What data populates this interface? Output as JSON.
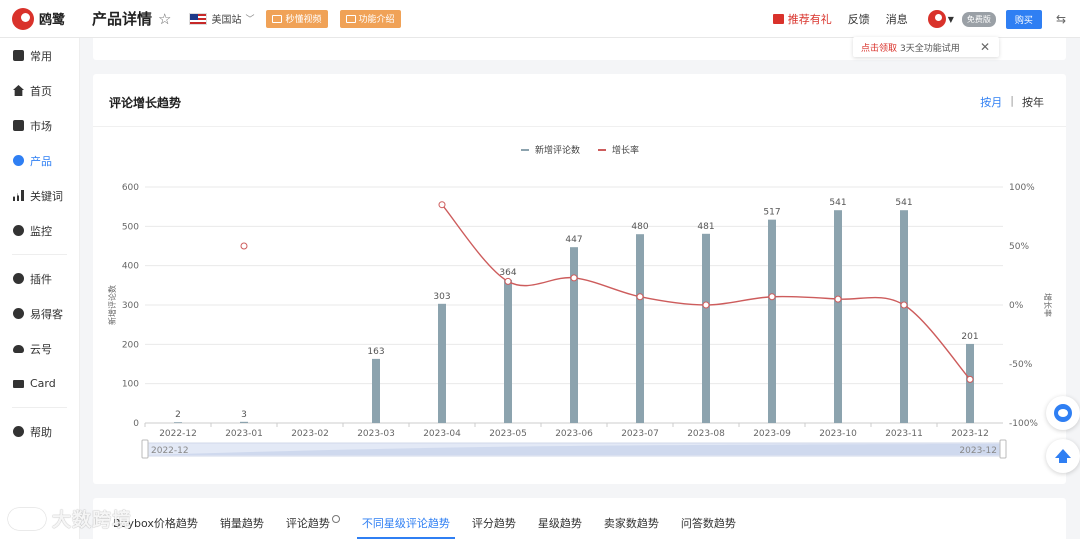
{
  "app": {
    "logo_text": "鸥鹭",
    "page_title": "产品详情"
  },
  "topbar": {
    "site": "美国站",
    "video_btn": "秒懂视频",
    "intro_btn": "功能介绍",
    "recommend": "推荐有礼",
    "feedback": "反馈",
    "messages": "消息",
    "edition": "免费版",
    "buy": "购买"
  },
  "toast": {
    "highlight": "点击领取",
    "text": "3天全功能试用"
  },
  "sidebar": {
    "items": [
      {
        "label": "常用",
        "icon": "common-icon"
      },
      {
        "label": "首页",
        "icon": "home-icon"
      },
      {
        "label": "市场",
        "icon": "market-icon"
      },
      {
        "label": "产品",
        "icon": "product-icon",
        "active": true
      },
      {
        "label": "关键词",
        "icon": "keyword-icon"
      },
      {
        "label": "监控",
        "icon": "monitor-icon"
      },
      {
        "label": "插件",
        "icon": "plugin-icon"
      },
      {
        "label": "易得客",
        "icon": "yideke-icon"
      },
      {
        "label": "云号",
        "icon": "cloud-icon"
      },
      {
        "label": "Card",
        "icon": "card-icon"
      },
      {
        "label": "帮助",
        "icon": "help-icon"
      }
    ]
  },
  "card": {
    "title": "评论增长趋势",
    "toggle_month": "按月",
    "toggle_year": "按年"
  },
  "chart_data": {
    "type": "bar",
    "title": "",
    "legend": [
      "新增评论数",
      "增长率"
    ],
    "legend_position": "top-center",
    "categories": [
      "2022-12",
      "2023-01",
      "2023-02",
      "2023-03",
      "2023-04",
      "2023-05",
      "2023-06",
      "2023-07",
      "2023-08",
      "2023-09",
      "2023-10",
      "2023-11",
      "2023-12"
    ],
    "series": [
      {
        "name": "新增评论数",
        "type": "bar",
        "axis": "left",
        "color": "#8ca3ae",
        "values": [
          2,
          3,
          null,
          163,
          303,
          364,
          447,
          480,
          481,
          517,
          541,
          541,
          201
        ],
        "labels": [
          "2",
          "3",
          "",
          "163",
          "303",
          "364",
          "447",
          "480",
          "481",
          "517",
          "541",
          "541",
          "201"
        ]
      },
      {
        "name": "增长率",
        "type": "line",
        "axis": "right",
        "color": "#cd5c5c",
        "values": [
          null,
          50,
          null,
          null,
          85,
          20,
          23,
          7,
          0,
          7,
          5,
          0,
          -63
        ]
      }
    ],
    "ylabel": "新增评论数",
    "y2label": "增长率",
    "ylim": [
      0,
      600
    ],
    "yticks": [
      "0",
      "100",
      "200",
      "300",
      "400",
      "500",
      "600"
    ],
    "y2lim": [
      -100,
      100
    ],
    "y2ticks": [
      "-100%",
      "-50%",
      "0%",
      "50%",
      "100%"
    ],
    "grid": true,
    "zoom_start": "2022-12",
    "zoom_end": "2023-12"
  },
  "tabs": {
    "items": [
      {
        "label": "Buybox价格趋势"
      },
      {
        "label": "销量趋势"
      },
      {
        "label": "评论趋势"
      },
      {
        "label": "不同星级评论趋势",
        "active": true
      },
      {
        "label": "评分趋势"
      },
      {
        "label": "星级趋势"
      },
      {
        "label": "卖家数趋势"
      },
      {
        "label": "问答数趋势"
      }
    ]
  },
  "watermark": {
    "text": "大数跨境"
  }
}
